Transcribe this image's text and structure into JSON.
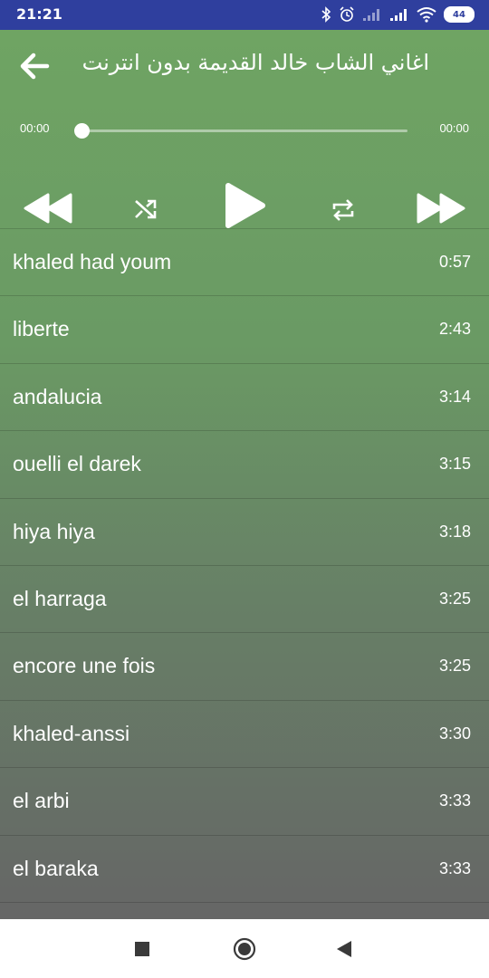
{
  "status_bar": {
    "time": "21:21",
    "battery": "44",
    "icons": [
      "bluetooth-icon",
      "alarm-icon",
      "signal-weak-icon",
      "signal-icon",
      "wifi-icon",
      "battery-icon"
    ]
  },
  "header": {
    "title": "اغاني الشاب خالد القديمة بدون انترنت",
    "back_icon": "arrow-back-icon"
  },
  "player": {
    "current_time": "00:00",
    "total_time": "00:00",
    "progress": 0,
    "controls": [
      "rewind-icon",
      "shuffle-icon",
      "play-icon",
      "repeat-icon",
      "fast-forward-icon"
    ]
  },
  "tracks": [
    {
      "title": "khaled had youm",
      "duration": "0:57"
    },
    {
      "title": "liberte",
      "duration": "2:43"
    },
    {
      "title": "andalucia",
      "duration": "3:14"
    },
    {
      "title": "ouelli el darek",
      "duration": "3:15"
    },
    {
      "title": "hiya hiya",
      "duration": "3:18"
    },
    {
      "title": "el harraga",
      "duration": "3:25"
    },
    {
      "title": "encore une fois",
      "duration": "3:25"
    },
    {
      "title": "khaled-anssi",
      "duration": "3:30"
    },
    {
      "title": "el arbi",
      "duration": "3:33"
    },
    {
      "title": "el baraka",
      "duration": "3:33"
    }
  ],
  "nav_bar": {
    "buttons": [
      "recents-icon",
      "home-icon",
      "back-triangle-icon"
    ]
  },
  "colors": {
    "status_bar": "#2f3f9e",
    "green_top": "#6fa463",
    "gray_bottom": "#666666",
    "text": "#ffffff"
  }
}
